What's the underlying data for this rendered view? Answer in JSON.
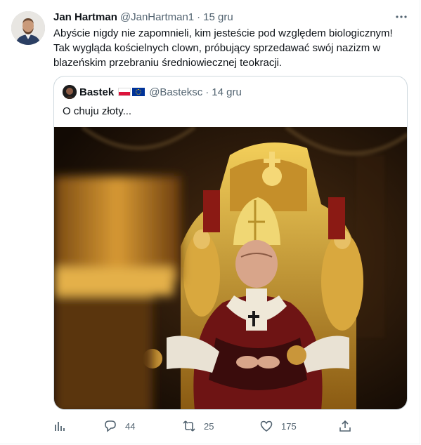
{
  "tweet": {
    "author_name": "Jan Hartman",
    "author_handle": "@JanHartman1",
    "separator": "·",
    "time": "15 gru",
    "text": "Abyście nigdy nie zapomnieli, kim jesteście pod względem biologicznym! Tak wygląda kościelnych clown, próbujący sprzedawać swój nazizm w blazeńskim przebraniu średniowiecznej teokracji."
  },
  "quoted_tweet": {
    "author_name": "Bastek",
    "author_handle": "@Basteksc",
    "separator": "·",
    "time": "14 gru",
    "text": "O chuju złoty..."
  },
  "actions": {
    "analytics_icon": "bar-chart-icon",
    "replies": "44",
    "retweets": "25",
    "likes": "175",
    "share_icon": "share-icon"
  },
  "colors": {
    "text": "#0f1419",
    "secondary": "#536471",
    "border": "#cfd9de"
  }
}
